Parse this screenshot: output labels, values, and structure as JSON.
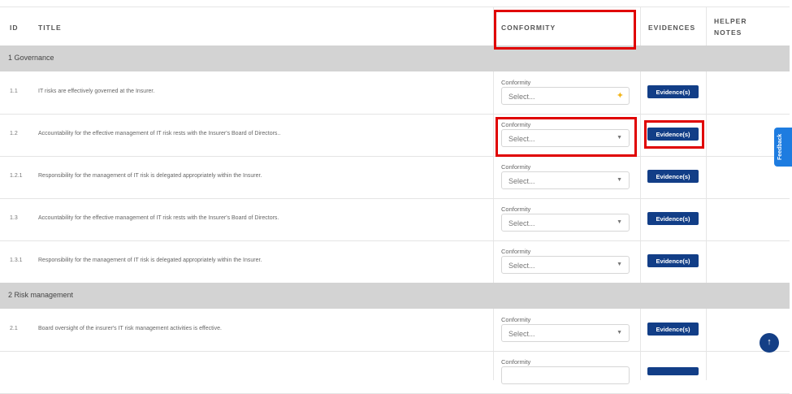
{
  "header": {
    "id": "ID",
    "title": "TITLE",
    "conformity": "CONFORMITY",
    "evidences": "EVIDENCES",
    "helper_line1": "HELPER",
    "helper_line2": "NOTES"
  },
  "sections": [
    {
      "label": "1 Governance"
    },
    {
      "label": "2 Risk management"
    }
  ],
  "rows": [
    {
      "id": "1.1",
      "title": "IT risks are effectively governed at the Insurer.",
      "conformity_label": "Conformity",
      "placeholder": "Select...",
      "evidence": "Evidence(s)"
    },
    {
      "id": "1.2",
      "title": "Accountability for the effective management of IT risk rests with the Insurer's Board of Directors..",
      "conformity_label": "Conformity",
      "placeholder": "Select...",
      "evidence": "Evidence(s)"
    },
    {
      "id": "1.2.1",
      "title": "Responsibility for the management of IT risk is delegated appropriately within the Insurer.",
      "conformity_label": "Conformity",
      "placeholder": "Select...",
      "evidence": "Evidence(s)"
    },
    {
      "id": "1.3",
      "title": "Accountability for the effective management of IT risk rests with the Insurer's Board of Directors.",
      "conformity_label": "Conformity",
      "placeholder": "Select...",
      "evidence": "Evidence(s)"
    },
    {
      "id": "1.3.1",
      "title": "Responsibility for the management of IT risk is delegated appropriately within the Insurer.",
      "conformity_label": "Conformity",
      "placeholder": "Select...",
      "evidence": "Evidence(s)"
    },
    {
      "id": "2.1",
      "title": "Board oversight of the insurer's IT risk management activities is effective.",
      "conformity_label": "Conformity",
      "placeholder": "Select...",
      "evidence": "Evidence(s)"
    },
    {
      "id": "",
      "title": "",
      "conformity_label": "Conformity",
      "placeholder": "",
      "evidence": ""
    }
  ],
  "feedback_tab": "Feedback",
  "scroll_top_icon": "arrow-up-icon",
  "accent_color": "#123e87",
  "highlight_color": "#e00000"
}
